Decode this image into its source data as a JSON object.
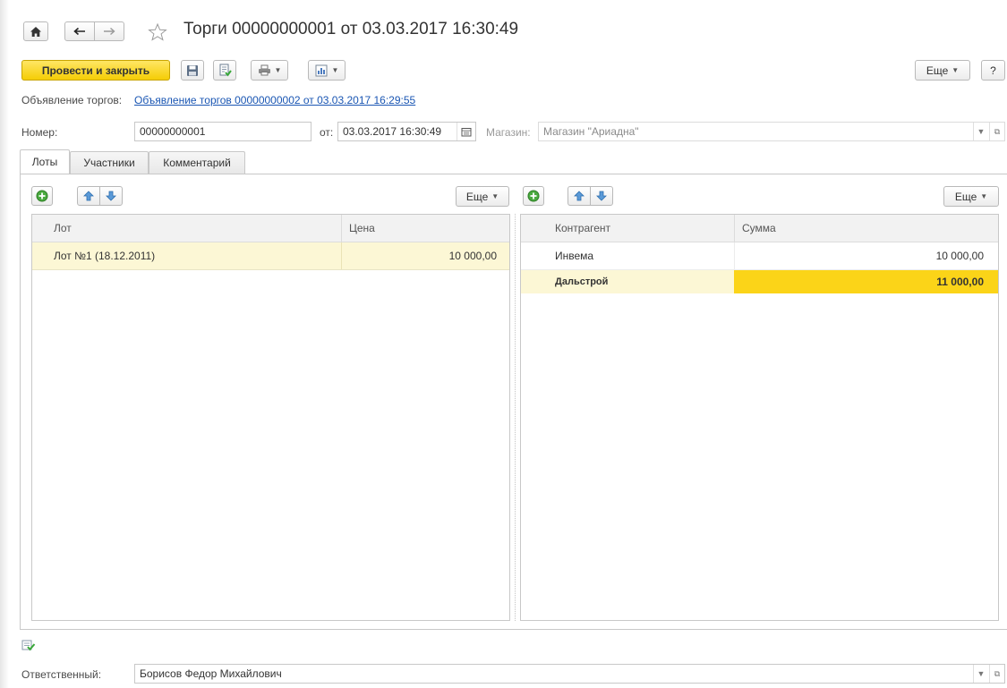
{
  "header": {
    "title": "Торги 00000000001 от 03.03.2017 16:30:49"
  },
  "toolbar": {
    "post_close_label": "Провести и закрыть",
    "more_label": "Еще",
    "help_label": "?"
  },
  "announcement": {
    "label": "Объявление торгов:",
    "link": "Объявление торгов 00000000002 от 03.03.2017 16:29:55"
  },
  "form": {
    "number_label": "Номер:",
    "number_value": "00000000001",
    "date_label": "от:",
    "date_value": "03.03.2017 16:30:49",
    "store_label": "Магазин:",
    "store_value": "Магазин \"Ариадна\""
  },
  "tabs": [
    {
      "label": "Лоты",
      "active": true
    },
    {
      "label": "Участники",
      "active": false
    },
    {
      "label": "Комментарий",
      "active": false
    }
  ],
  "lots_table": {
    "more_label": "Еще",
    "columns": [
      "Лот",
      "Цена"
    ],
    "rows": [
      {
        "lot": "Лот №1 (18.12.2011)",
        "price": "10 000,00"
      }
    ]
  },
  "bids_table": {
    "more_label": "Еще",
    "columns": [
      "Контрагент",
      "Сумма"
    ],
    "rows": [
      {
        "partner": "Инвема",
        "sum": "10 000,00"
      },
      {
        "partner": "Дальстрой",
        "sum": "11 000,00"
      }
    ]
  },
  "footer": {
    "responsible_label": "Ответственный:",
    "responsible_value": "Борисов Федор Михайлович"
  },
  "colors": {
    "accent": "#f5cd05",
    "selected_row": "#fcf7d5",
    "highlight_cell": "#fbd418",
    "link": "#1a56b3"
  }
}
